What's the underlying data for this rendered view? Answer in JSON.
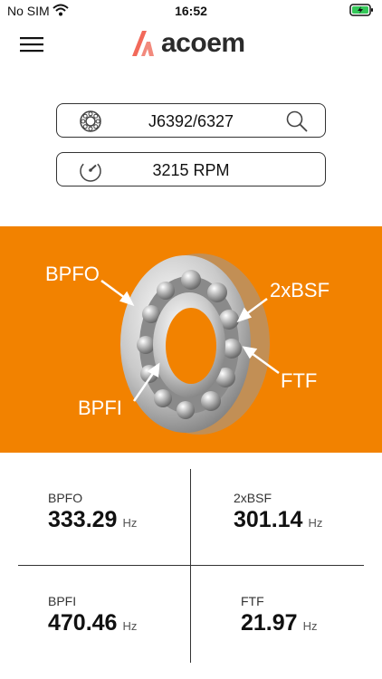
{
  "status_bar": {
    "carrier": "No SIM",
    "time": "16:52"
  },
  "header": {
    "logo_text": "acoem"
  },
  "bearing": {
    "value": "J6392/6327"
  },
  "speed": {
    "value": "3215 RPM"
  },
  "diagram": {
    "labels": [
      "BPFO",
      "2xBSF",
      "FTF",
      "BPFI"
    ]
  },
  "frequencies": [
    {
      "name": "BPFO",
      "value": "333.29",
      "unit": "Hz"
    },
    {
      "name": "2xBSF",
      "value": "301.14",
      "unit": "Hz"
    },
    {
      "name": "BPFI",
      "value": "470.46",
      "unit": "Hz"
    },
    {
      "name": "FTF",
      "value": "21.97",
      "unit": "Hz"
    }
  ],
  "colors": {
    "accent": "#f28200",
    "logo_mark": "#f2695a"
  }
}
